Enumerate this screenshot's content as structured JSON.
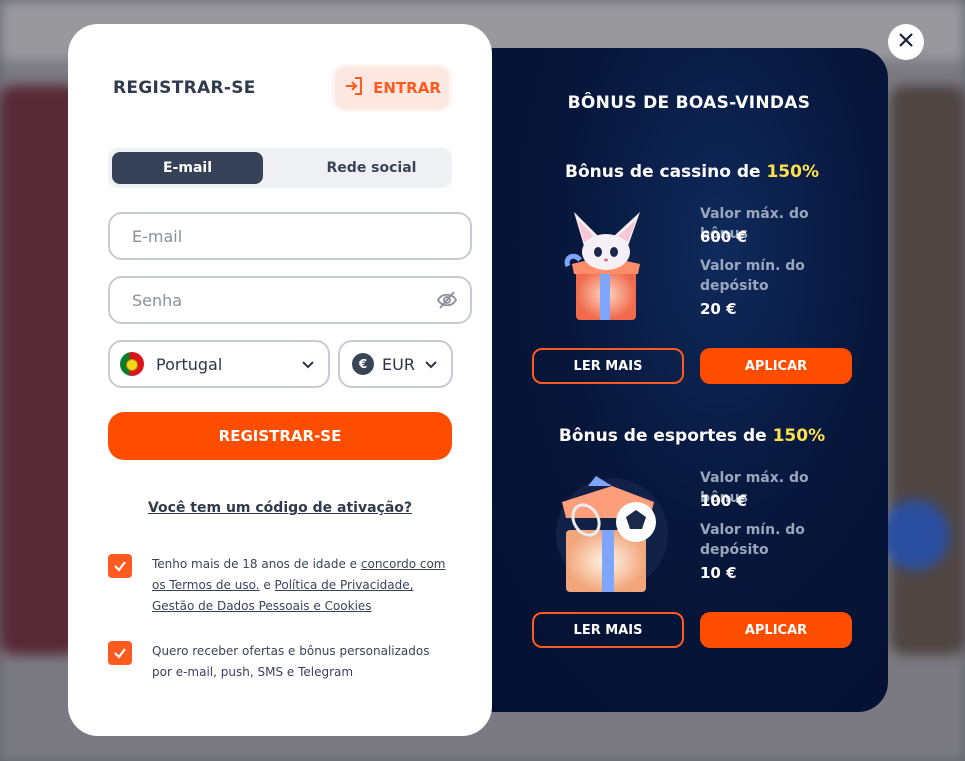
{
  "register_card": {
    "title": "REGISTRAR-SE",
    "login_label": "ENTRAR",
    "tabs": [
      {
        "label": "E-mail",
        "active": true
      },
      {
        "label": "Rede social",
        "active": false
      }
    ],
    "email_placeholder": "E-mail",
    "password_placeholder": "Senha",
    "country": "Portugal",
    "currency": "EUR",
    "currency_symbol": "€",
    "submit_label": "REGISTRAR-SE",
    "activation_code_link": "Você tem um código de ativação?",
    "terms": {
      "text_a": "Tenho mais de 18 anos de idade e ",
      "link_a": "concordo com os Termos de uso.",
      "text_b": " e ",
      "link_b": "Política de Privacidade, Gestão de Dados Pessoais e Cookies",
      "checked": true
    },
    "offers": {
      "text": "Quero receber ofertas e bônus personalizados por e-mail, push, SMS e Telegram",
      "checked": true
    }
  },
  "bonus_card": {
    "title": "BÔNUS DE BOAS-VINDAS",
    "bonuses": [
      {
        "title_prefix": "Bônus de cassino de ",
        "percent": "150%",
        "max_label": "Valor máx. do bônus",
        "max_value": "600 €",
        "min_label": "Valor mín. do depósito",
        "min_value": "20 €",
        "read_more": "LER MAIS",
        "apply": "APLICAR"
      },
      {
        "title_prefix": "Bônus de esportes de ",
        "percent": "150%",
        "max_label": "Valor máx. do bônus",
        "max_value": "100 €",
        "min_label": "Valor mín. do depósito",
        "min_value": "10 €",
        "read_more": "LER MAIS",
        "apply": "APLICAR"
      }
    ]
  },
  "colors": {
    "accent": "#ff4d00",
    "dark_panel": "#07163a",
    "highlight": "#ffe14d"
  }
}
